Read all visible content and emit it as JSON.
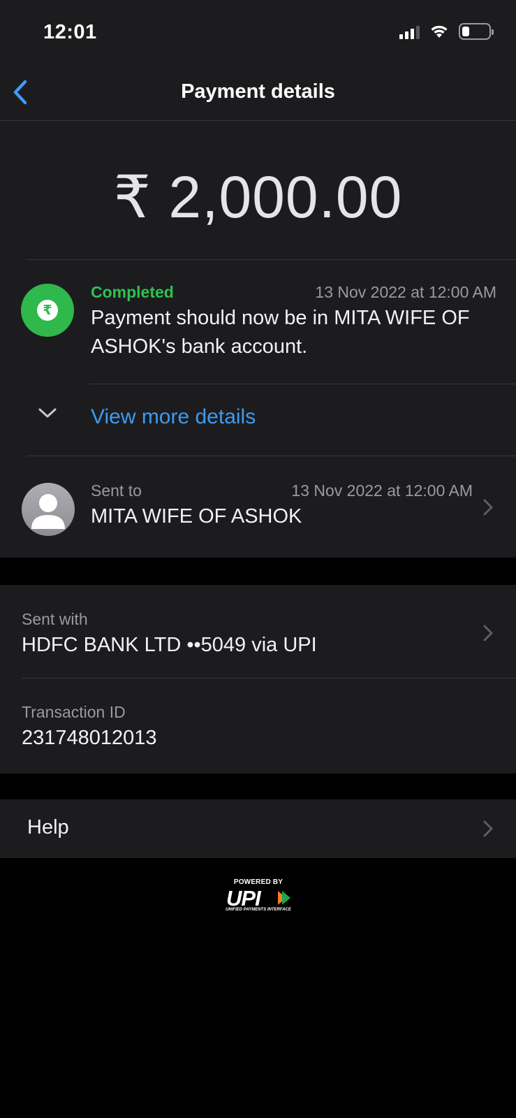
{
  "status_bar": {
    "time": "12:01",
    "signal_icon": "cellular-signal-icon",
    "wifi_icon": "wifi-icon",
    "battery_icon": "battery-icon"
  },
  "nav": {
    "title": "Payment details",
    "back_icon": "chevron-left-icon"
  },
  "payment": {
    "amount": "₹ 2,000.00",
    "status": "Completed",
    "status_time": "13 Nov 2022 at 12:00 AM",
    "description": "Payment should now be in MITA WIFE OF ASHOK's bank account.",
    "status_icon": "rupee-icon",
    "view_more_label": "View more details"
  },
  "recipient": {
    "label": "Sent to",
    "time": "13 Nov 2022 at 12:00 AM",
    "name": "MITA WIFE OF ASHOK"
  },
  "details": {
    "sent_with_label": "Sent with",
    "sent_with_value": "HDFC BANK LTD ••5049 via UPI",
    "transaction_label": "Transaction ID",
    "transaction_value": "231748012013"
  },
  "help": {
    "label": "Help"
  },
  "footer": {
    "powered_by": "POWERED BY",
    "upi": "UPI",
    "upi_full": "UNIFIED PAYMENTS INTERFACE"
  },
  "colors": {
    "background": "#000000",
    "card": "#1c1c1e",
    "success": "#30c150",
    "link": "#3d9bf0",
    "secondary_text": "#9a9a9f"
  }
}
